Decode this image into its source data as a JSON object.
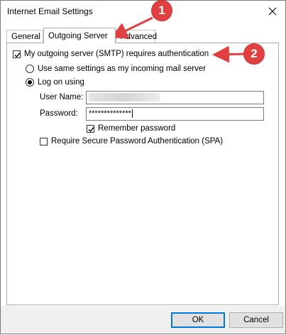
{
  "window": {
    "title": "Internet Email Settings",
    "close_icon": "close-icon"
  },
  "tabs": [
    {
      "label": "General",
      "active": false
    },
    {
      "label": "Outgoing Server",
      "active": true
    },
    {
      "label": "Advanced",
      "active": false
    }
  ],
  "outgoing": {
    "smtp_auth_label": "My outgoing server (SMTP) requires authentication",
    "smtp_auth_checked": true,
    "same_settings_label": "Use same settings as my incoming mail server",
    "same_settings_selected": false,
    "log_on_label": "Log on using",
    "log_on_selected": true,
    "username_label": "User Name:",
    "username_value": "",
    "password_label": "Password:",
    "password_value": "**************",
    "remember_label": "Remember password",
    "remember_checked": true,
    "spa_label": "Require Secure Password Authentication (SPA)",
    "spa_checked": false
  },
  "buttons": {
    "ok": "OK",
    "cancel": "Cancel"
  },
  "annotations": {
    "badge_1": "1",
    "badge_2": "2",
    "color": "#e04040"
  }
}
